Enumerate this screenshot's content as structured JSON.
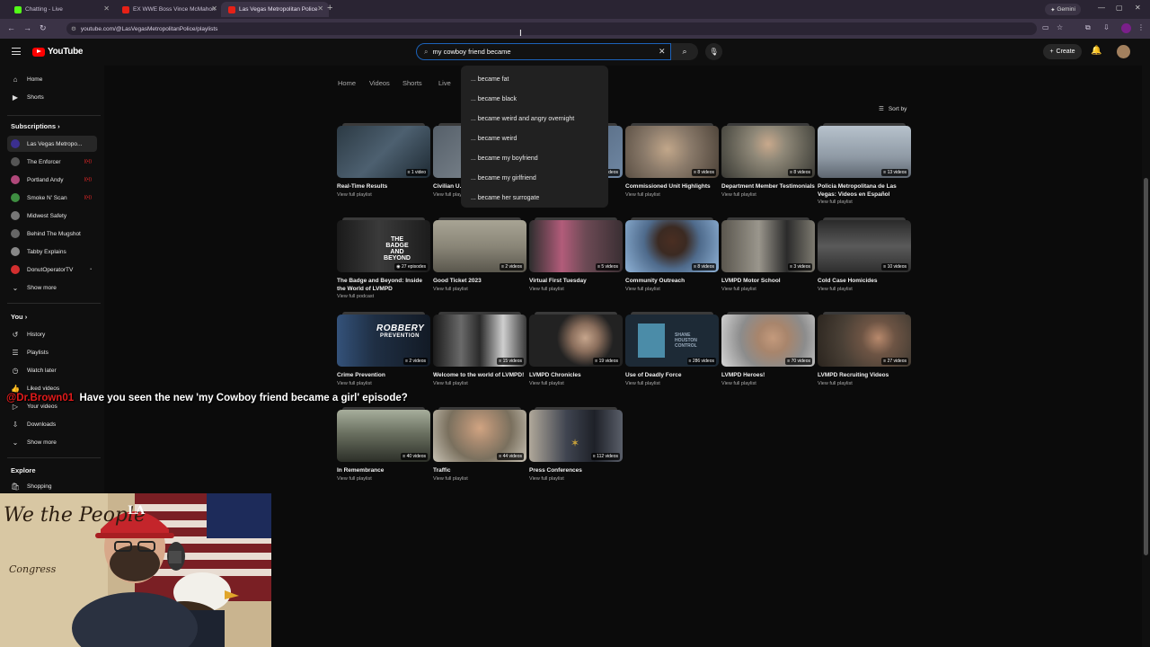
{
  "browser": {
    "tabs": [
      {
        "title": "Chatting - Live",
        "active": false
      },
      {
        "title": "EX WWE Boss Vince McMahon",
        "active": false
      },
      {
        "title": "Las Vegas Metropolitan Police",
        "active": true
      }
    ],
    "gemini_label": "Gemini",
    "url": "youtube.com/@LasVegasMetropolitanPolice/playlists"
  },
  "header": {
    "logo_text": "YouTube",
    "search_value": "my cowboy friend became ",
    "create_label": "Create"
  },
  "suggestions": [
    "... became fat",
    "... became black",
    "... became weird and angry overnight",
    "... became weird",
    "... became my boyfriend",
    "... became my girlfriend",
    "... became her surrogate"
  ],
  "sidebar": {
    "main": [
      {
        "label": "Home",
        "icon": "home-icon"
      },
      {
        "label": "Shorts",
        "icon": "shorts-icon"
      }
    ],
    "subscriptions_heading": "Subscriptions",
    "subscriptions": [
      {
        "label": "Las Vegas Metropo...",
        "color": "#3b2f8f",
        "live": false
      },
      {
        "label": "The Enforcer",
        "color": "#555555",
        "live": true
      },
      {
        "label": "Portland Andy",
        "color": "#b0487a",
        "live": true
      },
      {
        "label": "Smoke N' Scan",
        "color": "#3e8e41",
        "live": true
      },
      {
        "label": "Midwest Safety",
        "color": "#777777",
        "live": false
      },
      {
        "label": "Behind The Mugshot",
        "color": "#666666",
        "live": false
      },
      {
        "label": "Tabby Explains",
        "color": "#888888",
        "live": false
      },
      {
        "label": "DonutOperatorTV",
        "color": "#d32f2f",
        "live": false
      }
    ],
    "show_more": "Show more",
    "you_heading": "You",
    "you_items": [
      {
        "label": "History",
        "icon": "history-icon"
      },
      {
        "label": "Playlists",
        "icon": "playlists-icon"
      },
      {
        "label": "Watch later",
        "icon": "watch-later-icon"
      },
      {
        "label": "Liked videos",
        "icon": "like-icon"
      },
      {
        "label": "Your videos",
        "icon": "your-videos-icon"
      },
      {
        "label": "Downloads",
        "icon": "download-icon"
      }
    ],
    "show_more_2": "Show more",
    "explore_heading": "Explore",
    "explore_items": [
      {
        "label": "Shopping",
        "icon": "shopping-icon"
      }
    ]
  },
  "channel_tabs": [
    "Home",
    "Videos",
    "Shorts",
    "Live"
  ],
  "sort_label": "Sort by",
  "playlists": [
    {
      "title": "Real-Time Results",
      "count": "1 video",
      "link": "View full playlist",
      "bg": "#2c3a44"
    },
    {
      "title": "Civilian U...",
      "count": "",
      "link": "View full playlist",
      "bg": "#56606a"
    },
    {
      "title": "",
      "count": "...videos",
      "link": "",
      "bg": "#4a5b70"
    },
    {
      "title": "Commissioned Unit Highlights",
      "count": "8 videos",
      "link": "View full playlist",
      "bg": "#8a7a6a"
    },
    {
      "title": "Department Member Testimonials",
      "count": "8 videos",
      "link": "View full playlist",
      "bg": "#6e6a60"
    },
    {
      "title": "Policia Metropolitana de Las Vegas: Videos en Español",
      "count": "13 videos",
      "link": "View full playlist",
      "bg": "#8f9aa5"
    },
    {
      "title": "The Badge and Beyond: Inside the World of LVMPD",
      "count": "27 episodes",
      "link": "View full podcast",
      "bg": "#2a2a2a"
    },
    {
      "title": "Good Ticket 2023",
      "count": "2 videos",
      "link": "View full playlist",
      "bg": "#8a8678"
    },
    {
      "title": "Virtual First Tuesday",
      "count": "5 videos",
      "link": "View full playlist",
      "bg": "#6d4a55"
    },
    {
      "title": "Community Outreach",
      "count": "8 videos",
      "link": "View full playlist",
      "bg": "#4f6b8c"
    },
    {
      "title": "LVMPD Motor School",
      "count": "3 videos",
      "link": "View full playlist",
      "bg": "#7d7a70"
    },
    {
      "title": "Cold Case Homicides",
      "count": "10 videos",
      "link": "View full playlist",
      "bg": "#3e3e3e"
    },
    {
      "title": "Crime Prevention",
      "count": "2 videos",
      "link": "View full playlist",
      "bg": "#1f2f44"
    },
    {
      "title": "Welcome to the world of LVMPD!",
      "count": "15 videos",
      "link": "View full playlist",
      "bg": "#3a3a3a"
    },
    {
      "title": "LVMPD Chronicles",
      "count": "19 videos",
      "link": "View full playlist",
      "bg": "#222222"
    },
    {
      "title": "Use of Deadly Force",
      "count": "286 videos",
      "link": "View full playlist",
      "bg": "#1d2a36"
    },
    {
      "title": "LVMPD Heroes!",
      "count": "70 videos",
      "link": "View full playlist",
      "bg": "#8c8c8c"
    },
    {
      "title": "LVMPD Recruiting Videos",
      "count": "27 videos",
      "link": "View full playlist",
      "bg": "#4a4036"
    },
    {
      "title": "In Remembrance",
      "count": "40 videos",
      "link": "View full playlist",
      "bg": "#6a7060"
    },
    {
      "title": "Traffic",
      "count": "44 videos",
      "link": "View full playlist",
      "bg": "#7a705e"
    },
    {
      "title": "Press Conferences",
      "count": "112 videos",
      "link": "View full playlist",
      "bg": "#3f4450"
    }
  ],
  "thumb_texts": {
    "badge": "THE BADGE AND BEYOND",
    "robbery": "ROBBERY",
    "prevention": "PREVENTION",
    "shane": "SHANE HOUSTON CONTROL"
  },
  "chat_overlay": {
    "user": "@Dr.Brown01",
    "message": "Have you seen the new 'my Cowboy friend became a girl' episode?"
  },
  "webcam": {
    "banner_text": "We the People",
    "sub_text": "Congress",
    "cap_text": "LA"
  },
  "colors": {
    "accent_red": "#ff0000",
    "search_focus": "#1c62b9",
    "chat_user": "#e21b1b"
  }
}
